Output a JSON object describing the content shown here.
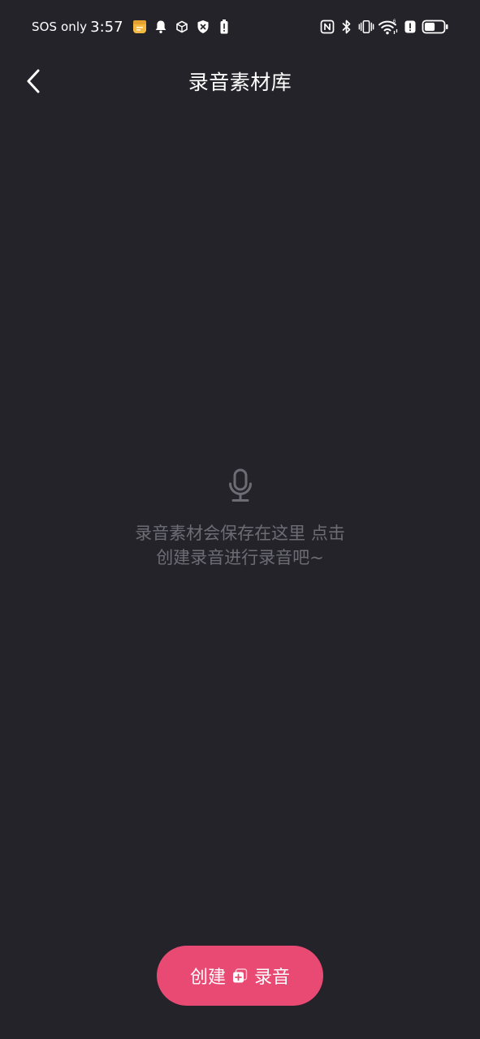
{
  "status_bar": {
    "carrier": "SOS only",
    "time": "3:57",
    "left_icons": [
      "notes-app-icon",
      "bell-icon",
      "cube-icon",
      "shield-x-icon",
      "battery-alert-icon"
    ],
    "right_icons": [
      "nfc-icon",
      "bluetooth-icon",
      "vibrate-icon",
      "wifi-icon",
      "alert-icon",
      "battery-icon"
    ],
    "battery_level": 0.55
  },
  "nav": {
    "title": "录音素材库",
    "back_icon": "chevron-left-icon"
  },
  "empty_state": {
    "icon": "microphone-icon",
    "message": "录音素材会保存在这里 点击创建录音进行录音吧~"
  },
  "create_button": {
    "label_left": "创建",
    "icon": "plus-square-icon",
    "label_right": "录音",
    "color": "#e94a73"
  },
  "colors": {
    "background": "#24232a",
    "muted_text": "#6d6c75",
    "accent": "#e94a73"
  }
}
